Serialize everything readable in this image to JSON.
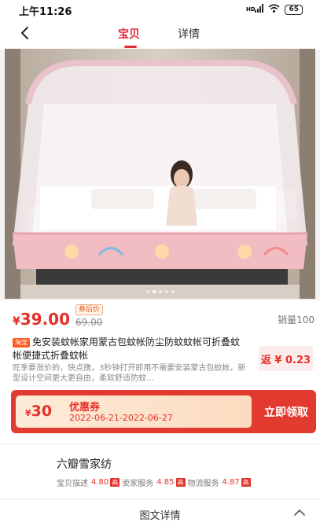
{
  "status_bar": {
    "time": "上午11:26",
    "signal": "HD",
    "battery": "65"
  },
  "nav": {
    "tabs": [
      {
        "label": "宝贝",
        "active": true
      },
      {
        "label": "详情",
        "active": false
      }
    ]
  },
  "gallery": {
    "image": "pink-mosquito-net-tent-photo",
    "total": 5,
    "current": 1
  },
  "product": {
    "currency": "¥",
    "price": "39.00",
    "coupon_after_tag": "券后价",
    "original_price": "69.00",
    "sales": "销量100",
    "platform_badge": "淘宝",
    "title": "免安装蚊帐家用蒙古包蚊帐防尘防蚊蚊帐可折叠蚊帐便捷式折叠蚊帐",
    "description": "旺季要涨价的，快点撸，3秒钟打开即用不需要安装蒙古包蚊帐，新型设计空间更大更自由，柔软舒适防蚊…",
    "rebate": "返 ¥ 0.23"
  },
  "coupon": {
    "currency": "¥",
    "amount": "30",
    "name": "优惠券",
    "date_range": "2022-06-21-2022-06-27",
    "button": "立即领取"
  },
  "shop": {
    "name": "六瓣雪家纺",
    "ratings": [
      {
        "label": "宝贝描述",
        "value": "4.80",
        "level": "高"
      },
      {
        "label": "卖家服务",
        "value": "4.85",
        "level": "高"
      },
      {
        "label": "物流服务",
        "value": "4.87",
        "level": "高"
      }
    ]
  },
  "detail_section": {
    "title": "图文详情"
  },
  "colors": {
    "accent": "#e5312b",
    "coupon_bg": "#e23a2e"
  }
}
